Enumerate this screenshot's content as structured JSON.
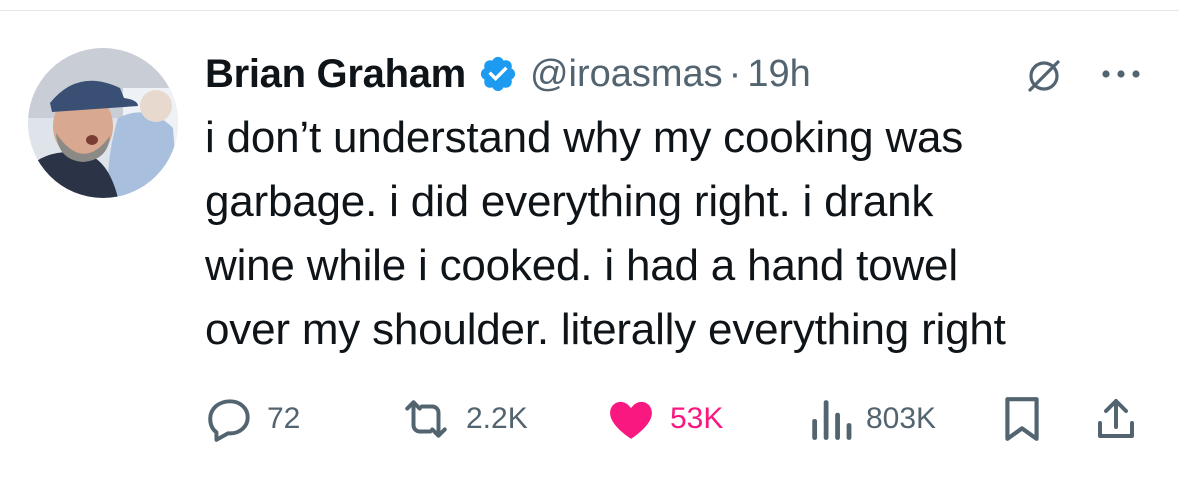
{
  "tweet": {
    "author": {
      "display_name": "Brian Graham",
      "handle": "@iroasmas",
      "verified": true
    },
    "time": "19h",
    "separator": "·",
    "text_lines": [
      "i don’t understand why my cooking was",
      "garbage. i did everything right. i drank",
      "wine while i cooked. i had a hand towel",
      "over my shoulder. literally everything right"
    ],
    "stats": {
      "replies": "72",
      "reposts": "2.2K",
      "likes": "53K",
      "views": "803K"
    },
    "liked": true
  },
  "icons": {
    "verified": "verified-badge-icon",
    "grok": "grok-icon",
    "more": "more-icon",
    "reply": "reply-icon",
    "repost": "repost-icon",
    "like": "heart-icon",
    "views": "views-icon",
    "bookmark": "bookmark-icon",
    "share": "share-icon"
  },
  "colors": {
    "text": "#0f1419",
    "secondary": "#536471",
    "verified": "#1d9bf0",
    "like": "#f91880"
  }
}
